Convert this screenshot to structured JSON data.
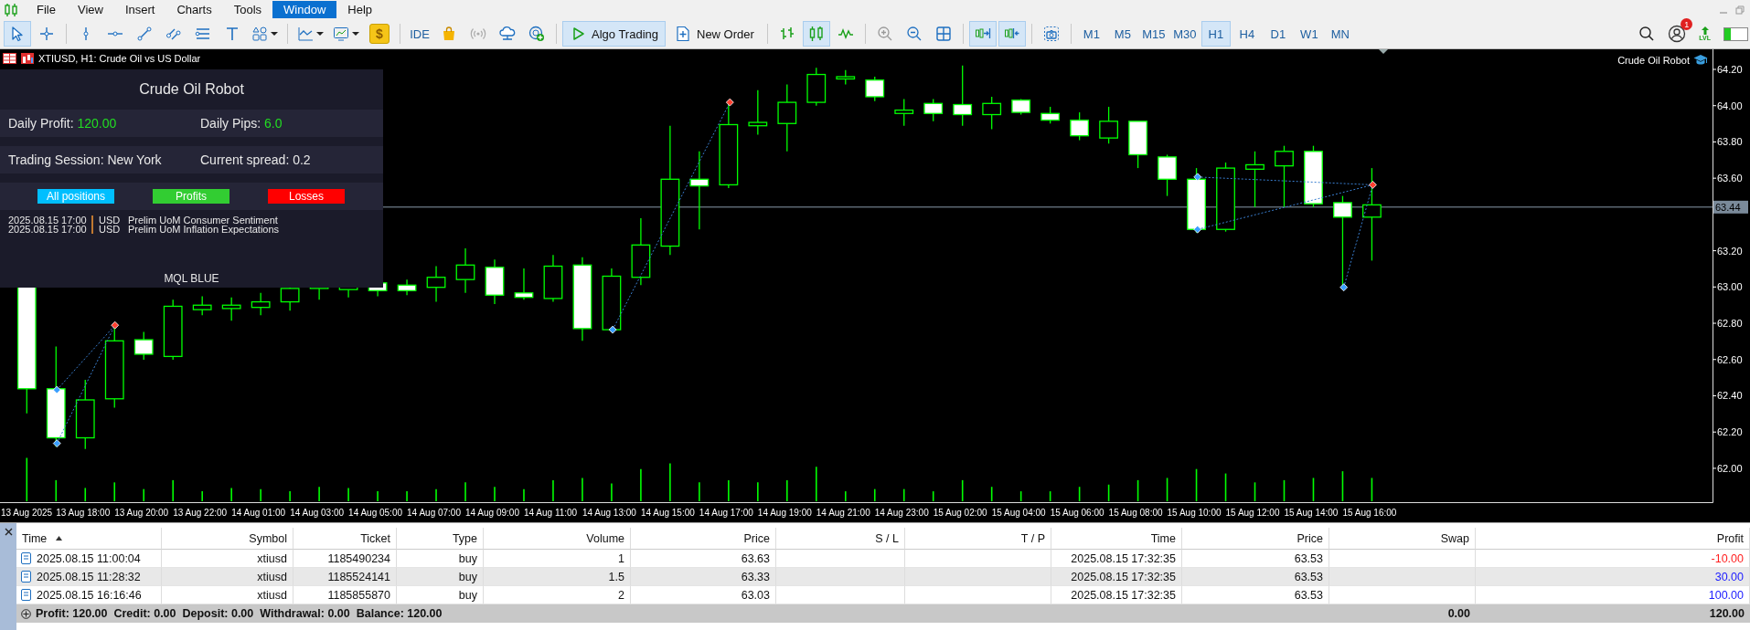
{
  "menu": [
    {
      "label": "File",
      "selected": false
    },
    {
      "label": "View",
      "selected": false
    },
    {
      "label": "Insert",
      "selected": false
    },
    {
      "label": "Charts",
      "selected": false
    },
    {
      "label": "Tools",
      "selected": false
    },
    {
      "label": "Window",
      "selected": true
    },
    {
      "label": "Help",
      "selected": false
    }
  ],
  "toolbar": {
    "items": [
      {
        "kind": "tool",
        "selected": true
      },
      {
        "kind": "tool",
        "selected": false
      },
      {
        "kind": "separator"
      },
      {
        "kind": "tool",
        "selected": false
      },
      {
        "kind": "tool",
        "selected": false
      },
      {
        "kind": "tool",
        "selected": false
      },
      {
        "kind": "tool",
        "selected": false
      },
      {
        "kind": "tool",
        "selected": false
      },
      {
        "kind": "tool",
        "selected": false
      },
      {
        "kind": "dropdown",
        "selected": false
      },
      {
        "kind": "separator"
      },
      {
        "kind": "dropdown",
        "selected": false
      },
      {
        "kind": "dropdown",
        "selected": false
      },
      {
        "kind": "glyph",
        "label": "$"
      },
      {
        "kind": "separator"
      },
      {
        "kind": "text",
        "label": "IDE"
      },
      {
        "kind": "tool",
        "selected": false
      },
      {
        "kind": "tool",
        "selected": false
      },
      {
        "kind": "tool",
        "selected": false
      },
      {
        "kind": "tool",
        "selected": false
      },
      {
        "kind": "separator"
      },
      {
        "kind": "action",
        "label": "Algo Trading",
        "selected": true
      },
      {
        "kind": "action",
        "label": "New Order",
        "selected": false
      },
      {
        "kind": "separator"
      },
      {
        "kind": "tool",
        "selected": false
      },
      {
        "kind": "tool",
        "selected": true
      },
      {
        "kind": "tool",
        "selected": false
      },
      {
        "kind": "separator"
      },
      {
        "kind": "tool",
        "selected": false
      },
      {
        "kind": "tool",
        "selected": false
      },
      {
        "kind": "tool",
        "selected": false
      },
      {
        "kind": "separator"
      },
      {
        "kind": "tool",
        "selected": true
      },
      {
        "kind": "tool",
        "selected": true
      },
      {
        "kind": "separator"
      },
      {
        "kind": "tool",
        "selected": false
      },
      {
        "kind": "separator"
      }
    ],
    "timeframes": [
      {
        "label": "M1",
        "selected": false
      },
      {
        "label": "M5",
        "selected": false
      },
      {
        "label": "M15",
        "selected": false
      },
      {
        "label": "M30",
        "selected": false
      },
      {
        "label": "H1",
        "selected": true
      },
      {
        "label": "H4",
        "selected": false
      },
      {
        "label": "D1",
        "selected": false
      },
      {
        "label": "W1",
        "selected": false
      },
      {
        "label": "MN",
        "selected": false
      }
    ],
    "notification_count": "1",
    "level_label": "LVL"
  },
  "chart": {
    "title": "XTIUSD, H1: Crude Oil vs US Dollar",
    "robot_label": "Crude Oil Robot",
    "price_axis": [
      "64.20",
      "64.00",
      "63.80",
      "63.60",
      "63.20",
      "63.00",
      "62.80",
      "62.60",
      "62.40",
      "62.20",
      "62.00"
    ],
    "current_price": "63.44",
    "time_axis": [
      "13 Aug 2025",
      "13 Aug 18:00",
      "13 Aug 20:00",
      "13 Aug 22:00",
      "14 Aug 01:00",
      "14 Aug 03:00",
      "14 Aug 05:00",
      "14 Aug 07:00",
      "14 Aug 09:00",
      "14 Aug 11:00",
      "14 Aug 13:00",
      "14 Aug 15:00",
      "14 Aug 17:00",
      "14 Aug 19:00",
      "14 Aug 21:00",
      "14 Aug 23:00",
      "15 Aug 02:00",
      "15 Aug 04:00",
      "15 Aug 06:00",
      "15 Aug 08:00",
      "15 Aug 10:00",
      "15 Aug 12:00",
      "15 Aug 14:00",
      "15 Aug 16:00"
    ]
  },
  "panel": {
    "title": "Crude Oil Robot",
    "rows": [
      [
        {
          "label": "Daily Profit:",
          "value": "120.00"
        },
        {
          "label": "Daily Pips:",
          "value": "6.0"
        }
      ],
      [
        {
          "label": "Trading Session:",
          "value": "New York"
        },
        {
          "label": "Current spread:",
          "value": "0.2"
        }
      ]
    ],
    "buttons": [
      {
        "label": "All positions",
        "color": "#00bfff"
      },
      {
        "label": "Profits",
        "color": "#32cd32"
      },
      {
        "label": "Losses",
        "color": "#ff0000"
      }
    ],
    "news": [
      {
        "time": "2025.08.15 17:00",
        "currency": "USD",
        "event": "Prelim UoM Consumer Sentiment"
      },
      {
        "time": "2025.08.15 17:00",
        "currency": "USD",
        "event": "Prelim UoM Inflation Expectations"
      }
    ],
    "footer": "MQL BLUE"
  },
  "table": {
    "columns": [
      {
        "label": "Time",
        "sorted": true
      },
      {
        "label": "Symbol",
        "sorted": false
      },
      {
        "label": "Ticket",
        "sorted": false
      },
      {
        "label": "Type",
        "sorted": false
      },
      {
        "label": "Volume",
        "sorted": false
      },
      {
        "label": "Price",
        "sorted": false
      },
      {
        "label": "S / L",
        "sorted": false
      },
      {
        "label": "T / P",
        "sorted": false
      },
      {
        "label": "Time",
        "sorted": false
      },
      {
        "label": "Price",
        "sorted": false
      },
      {
        "label": "Swap",
        "sorted": false
      },
      {
        "label": "Profit",
        "sorted": false
      }
    ],
    "rows": [
      {
        "time": "2025.08.15 11:00:04",
        "symbol": "xtiusd",
        "ticket": "1185490234",
        "type": "buy",
        "volume": "1",
        "price": "63.63",
        "close_time": "2025.08.15 17:32:35",
        "close_price": "63.53",
        "profit": "-10.00",
        "color": "#ff2020"
      },
      {
        "time": "2025.08.15 11:28:32",
        "symbol": "xtiusd",
        "ticket": "1185524141",
        "type": "buy",
        "volume": "1.5",
        "price": "63.33",
        "close_time": "2025.08.15 17:32:35",
        "close_price": "63.53",
        "profit": "30.00",
        "color": "#2020ff"
      },
      {
        "time": "2025.08.15 16:16:46",
        "symbol": "xtiusd",
        "ticket": "1185855870",
        "type": "buy",
        "volume": "2",
        "price": "63.03",
        "close_time": "2025.08.15 17:32:35",
        "close_price": "63.53",
        "profit": "100.00",
        "color": "#2020ff"
      }
    ],
    "summary": {
      "text": "Profit: 120.00  Credit: 0.00  Deposit: 0.00  Withdrawal: 0.00  Balance: 120.00",
      "swap": "0.00",
      "profit": "120.00"
    }
  }
}
